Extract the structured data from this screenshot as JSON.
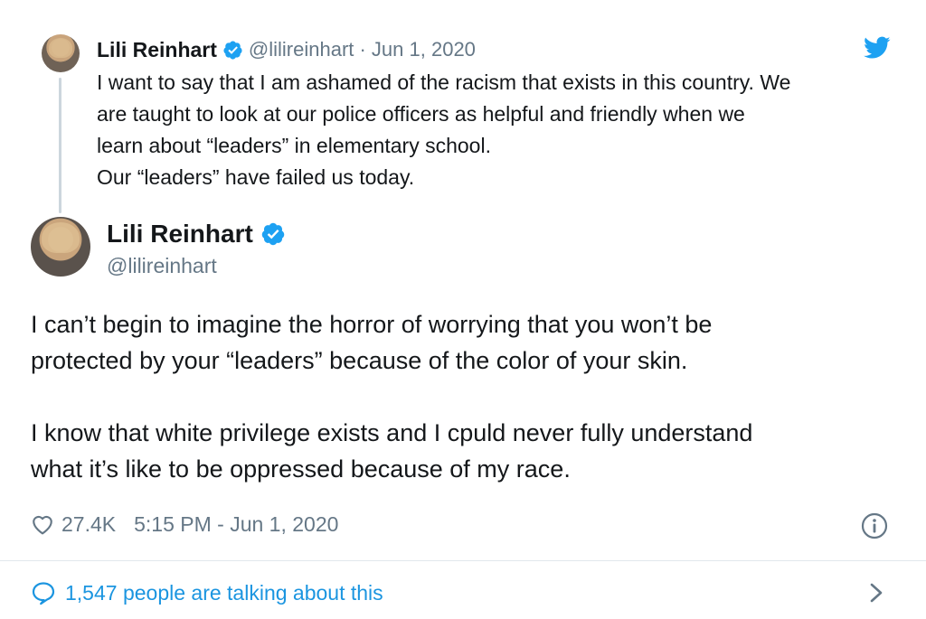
{
  "quoted_tweet": {
    "author_name": "Lili Reinhart",
    "meta": "@lilireinhart · Jun 1, 2020",
    "lines": [
      "I want to say that I am ashamed of the racism that exists in this country. We",
      "are taught to look at our police officers as helpful and friendly when we",
      "learn about “leaders” in elementary school.",
      "Our “leaders” have failed us today."
    ]
  },
  "tweet": {
    "author_name": "Lili Reinhart",
    "handle": "@lilireinhart",
    "paragraph1": [
      "I can’t begin to imagine the horror of worrying that you won’t be",
      "protected by your “leaders” because of the color of your skin."
    ],
    "paragraph2": [
      "I know that white privilege exists and I cpuld never fully understand",
      "what it’s like to be oppressed because of my race."
    ],
    "likes": "27.4K",
    "timestamp": "5:15 PM - Jun 1, 2020"
  },
  "footer": {
    "talking_label": "1,547 people are talking about this"
  },
  "icons": {
    "verified": "verified-badge-icon",
    "brand": "twitter-bird-icon",
    "like": "heart-icon",
    "info": "info-icon",
    "reply": "speech-bubble-icon",
    "more": "chevron-right-icon"
  },
  "colors": {
    "accent": "#1da1f2",
    "link": "#1b95e0",
    "secondary_text": "#657786",
    "primary_text": "#14171a"
  }
}
